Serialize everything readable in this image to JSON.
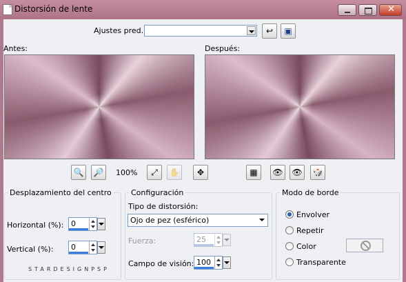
{
  "window": {
    "title": "Distorsión de lente"
  },
  "presets": {
    "label": "Ajustes pred.:",
    "value": ""
  },
  "previews": {
    "before_label": "Antes:",
    "after_label": "Después:"
  },
  "zoom": {
    "level": "100%"
  },
  "center_offset": {
    "title": "Desplazamiento del centro",
    "horizontal_label": "Horizontal (%):",
    "horizontal_value": "0",
    "vertical_label": "Vertical (%):",
    "vertical_value": "0"
  },
  "config": {
    "title": "Configuración",
    "distortion_type_label": "Tipo de distorsión:",
    "distortion_type_value": "Ojo de pez (esférico)",
    "strength_label": "Fuerza:",
    "strength_value": "25",
    "fov_label": "Campo de visión:",
    "fov_value": "100"
  },
  "edge_mode": {
    "title": "Modo de borde",
    "options": [
      "Envolver",
      "Repetir",
      "Color",
      "Transparente"
    ],
    "selected": "Envolver"
  },
  "watermark": "STARDESIGNPSP",
  "icons": [
    "app-icon",
    "minimize-icon",
    "maximize-icon",
    "close-icon",
    "reset-icon",
    "save-icon",
    "zoom-in-icon",
    "zoom-out-icon",
    "fit-icon",
    "hand-icon",
    "move-icon",
    "split-view-icon",
    "randomize-icon"
  ]
}
